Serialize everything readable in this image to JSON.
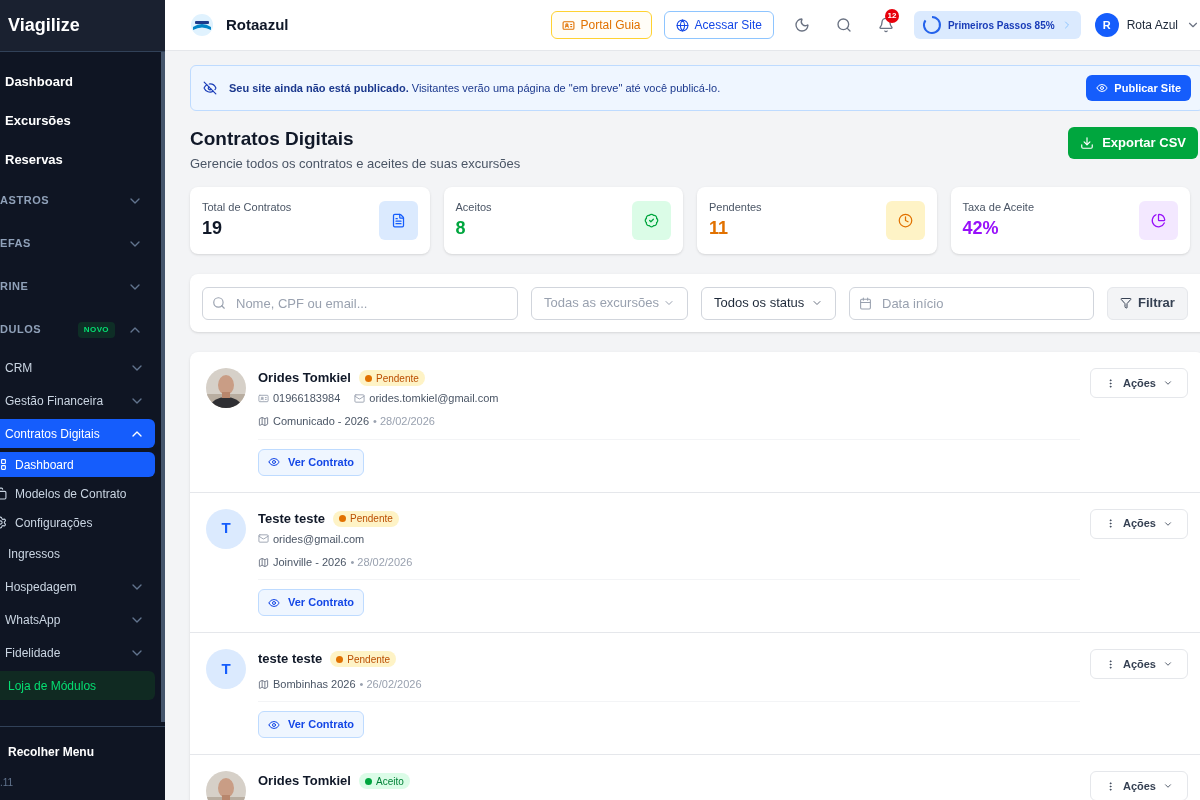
{
  "sidebar": {
    "brand": "Viagilize",
    "items": [
      {
        "kind": "link",
        "label": "Dashboard"
      },
      {
        "kind": "link",
        "label": "Excursões"
      },
      {
        "kind": "link",
        "label": "Reservas"
      },
      {
        "kind": "section",
        "label": "ASTROS",
        "expanded": false
      },
      {
        "kind": "section",
        "label": "EFAS",
        "expanded": false
      },
      {
        "kind": "section",
        "label": "RINE",
        "expanded": false
      },
      {
        "kind": "section",
        "label": "DULOS",
        "badge": "NOVO",
        "expanded": true
      },
      {
        "kind": "group",
        "label": "CRM",
        "expanded": false,
        "selected": false
      },
      {
        "kind": "group",
        "label": "Gestão Financeira",
        "expanded": false,
        "selected": false
      },
      {
        "kind": "group",
        "label": "Contratos Digitais",
        "expanded": true,
        "selected": true,
        "children": [
          {
            "label": "Dashboard",
            "selected": true
          },
          {
            "label": "Modelos de Contrato",
            "selected": false
          },
          {
            "label": "Configurações",
            "selected": false
          }
        ]
      },
      {
        "kind": "plain",
        "label": "Ingressos"
      },
      {
        "kind": "group",
        "label": "Hospedagem",
        "expanded": false,
        "selected": false
      },
      {
        "kind": "group",
        "label": "WhatsApp",
        "expanded": false,
        "selected": false
      },
      {
        "kind": "group",
        "label": "Fidelidade",
        "expanded": false,
        "selected": false
      },
      {
        "kind": "store",
        "label": "Loja de Módulos"
      }
    ],
    "collapse": "Recolher Menu",
    "version": ".11"
  },
  "header": {
    "company": "Rotaazul",
    "portal": "Portal Guia",
    "site": "Acessar Site",
    "notifications": "12",
    "progress": {
      "label": "Primeiros Passos 85%"
    },
    "user_initial": "R",
    "user_name": "Rota Azul"
  },
  "banner": {
    "text": "**Seu site ainda não está publicado.** Visitantes verão uma página de \"em breve\" até você publicá-lo.",
    "button": "Publicar Site"
  },
  "page": {
    "title": "Contratos Digitais",
    "subtitle": "Gerencie todos os contratos e aceites de suas excursões",
    "export": "Exportar CSV"
  },
  "stats": [
    {
      "kind": "total",
      "label": "Total de Contratos",
      "value": "19"
    },
    {
      "kind": "accepted",
      "label": "Aceitos",
      "value": "8"
    },
    {
      "kind": "pending",
      "label": "Pendentes",
      "value": "11"
    },
    {
      "kind": "rate",
      "label": "Taxa de Aceite",
      "value": "42%"
    }
  ],
  "filters": {
    "search": {
      "placeholder": "Nome, CPF ou email..."
    },
    "excursion": {
      "placeholder": "Todas as excursões"
    },
    "status": {
      "value": "Todos os status"
    },
    "date": {
      "placeholder": "Data início"
    },
    "button": "Filtrar"
  },
  "contracts": [
    {
      "name": "Orides Tomkiel",
      "status": {
        "kind": "pending",
        "label": "Pendente"
      },
      "phone": "01966183984",
      "email": "orides.tomkiel@gmail.com",
      "trip": "Comunicado - 2026",
      "date": "• 28/02/2026",
      "view": "Ver Contrato",
      "actions": "Ações"
    },
    {
      "avatar": {
        "kind": "initial",
        "initial": "T"
      },
      "name": "Teste teste",
      "status": {
        "kind": "pending",
        "label": "Pendente"
      },
      "email": "orides@gmail.com",
      "trip": "Joinville - 2026",
      "date": "• 28/02/2026",
      "view": "Ver Contrato",
      "actions": "Ações"
    },
    {
      "avatar": {
        "kind": "initial",
        "initial": "T"
      },
      "name": "teste teste",
      "status": {
        "kind": "pending",
        "label": "Pendente"
      },
      "trip": "Bombinhas 2026",
      "date": "• 26/02/2026",
      "view": "Ver Contrato",
      "actions": "Ações"
    },
    {
      "name": "Orides Tomkiel",
      "status": {
        "kind": "accepted",
        "label": "Aceito"
      },
      "actions": "Ações"
    }
  ]
}
